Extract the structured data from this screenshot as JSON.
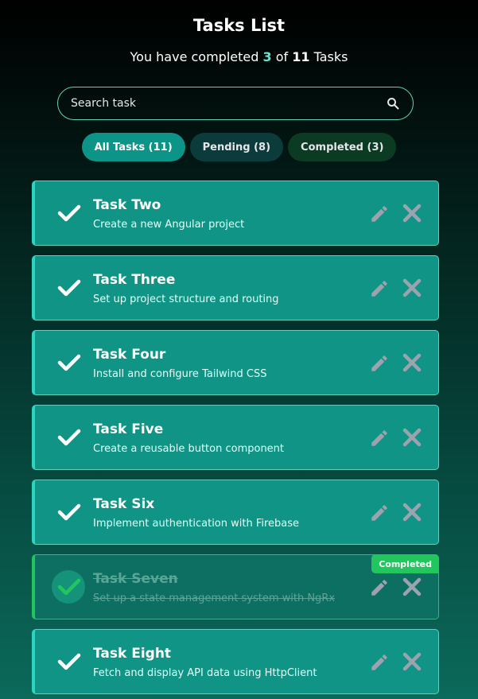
{
  "header": {
    "title": "Tasks List",
    "subtitle_prefix": "You have completed",
    "completed_count": "3",
    "subtitle_of": "of",
    "total_count": "11",
    "subtitle_suffix": "Tasks"
  },
  "search": {
    "placeholder": "Search task",
    "value": ""
  },
  "filters": {
    "all": "All Tasks (11)",
    "pending": "Pending (8)",
    "completed": "Completed (3)"
  },
  "colors": {
    "accent": "#0d9488",
    "card": "#0f9485",
    "completed_badge": "#22c55e",
    "count_highlight": "#5eead4"
  },
  "tasks": [
    {
      "title": "Task Two",
      "description": "Create a new Angular project",
      "completed": false
    },
    {
      "title": "Task Three",
      "description": "Set up project structure and routing",
      "completed": false
    },
    {
      "title": "Task Four",
      "description": "Install and configure Tailwind CSS",
      "completed": false
    },
    {
      "title": "Task Five",
      "description": "Create a reusable button component",
      "completed": false
    },
    {
      "title": "Task Six",
      "description": "Implement authentication with Firebase",
      "completed": false
    },
    {
      "title": "Task Seven",
      "description": "Set up a state management system with NgRx",
      "completed": true,
      "badge": "Completed"
    },
    {
      "title": "Task Eight",
      "description": "Fetch and display API data using HttpClient",
      "completed": false
    }
  ],
  "icons": {
    "check": "check-icon",
    "edit": "pencil-icon",
    "delete": "close-icon",
    "search": "search-icon"
  }
}
